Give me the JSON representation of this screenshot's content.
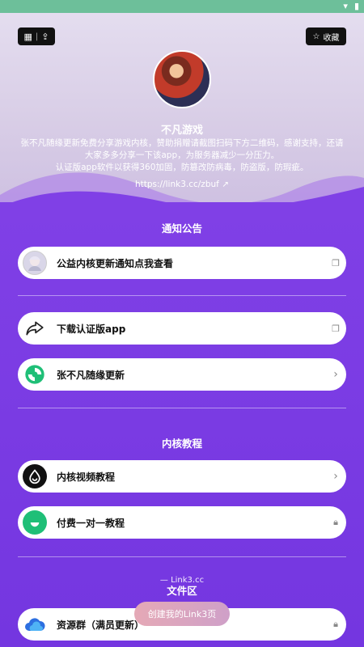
{
  "colors": {
    "accent": "#7a3fe0",
    "hero_bg": "#e4ddef",
    "status_bar": "#6dbf9a",
    "card_bg": "#ffffff"
  },
  "top_left_icons": [
    "qr-code-icon",
    "share-icon"
  ],
  "top_right_button": {
    "label": "收藏",
    "icon": "star-icon"
  },
  "profile": {
    "name": "不凡游戏",
    "description_line1": "张不凡随缘更新免费分享游戏内核，赞助捐赠请截图扫码下方二维码，感谢支持，还请",
    "description_line2": "大家多多分享一下该app，为服务器减少一分压力。",
    "description_line3": "认证版app软件以获得360加固，防篡改防病毒，防盗版，防瑕疵。",
    "link": "https://link3.cc/zbuf"
  },
  "sections": {
    "notice_title": "通知公告",
    "tutorial_title": "内核教程",
    "files_title": "文件区"
  },
  "items": {
    "notice": {
      "label": "公益内核更新通知点我查看",
      "icon": "anime-avatar-icon",
      "trail_icon": "copy-icon"
    },
    "download": {
      "label": "下载认证版app",
      "icon": "share-arrow-icon",
      "trail_icon": "copy-icon"
    },
    "zhangbufan": {
      "label": "张不凡随缘更新",
      "icon": "green-swirl-icon",
      "trail_icon": "chevron-right-icon"
    },
    "video": {
      "label": "内核视频教程",
      "icon": "drop-icon",
      "trail_icon": "chevron-right-icon"
    },
    "paid": {
      "label": "付费一对一教程",
      "icon": "green-bubble-icon",
      "trail_icon": "lock-icon"
    },
    "resource": {
      "label": "资源群（满员更新）",
      "icon": "cloud-icon",
      "trail_icon": "lock-icon"
    }
  },
  "watermark": "— Link3.cc",
  "create_button": "创建我的Link3页"
}
